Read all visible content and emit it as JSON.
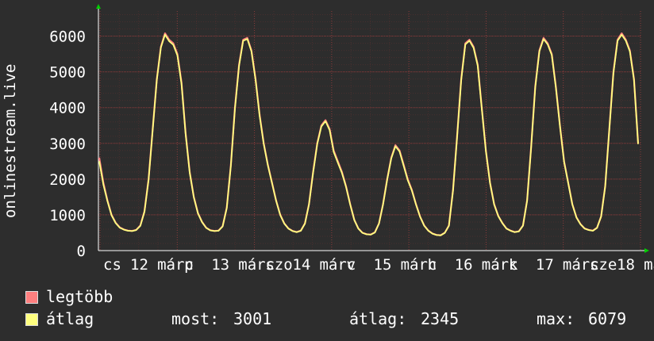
{
  "chart_data": {
    "type": "line",
    "ylabel": "onlinestream.live",
    "ylim": [
      0,
      6700
    ],
    "yticks": [
      0,
      1000,
      2000,
      3000,
      4000,
      5000,
      6000
    ],
    "x_tick_labels": [
      "cs",
      "12",
      "márc",
      "p",
      "13",
      "márc",
      "szo",
      "14",
      "márc",
      "v",
      "15",
      "márc",
      "h",
      "16",
      "márc",
      "k",
      "17",
      "márc",
      "sze",
      "18",
      "márc"
    ],
    "grid": true,
    "colors": {
      "background": "#2d2d2d",
      "plot_background": "#2d2d2d",
      "grid": "#5a3030",
      "axis": "#ffffff",
      "max_series": "#ff7f7f",
      "avg_series": "#ffff7f",
      "arrow": "#00cc00"
    },
    "series": [
      {
        "name": "legtöbb",
        "color": "#ff7f7f",
        "values": [
          2600,
          1900,
          1400,
          1000,
          780,
          650,
          590,
          560,
          550,
          580,
          700,
          1100,
          2000,
          3400,
          4800,
          5700,
          6079,
          5900,
          5800,
          5500,
          4700,
          3300,
          2200,
          1500,
          1050,
          800,
          640,
          570,
          550,
          560,
          680,
          1200,
          2400,
          4000,
          5200,
          5900,
          5950,
          5600,
          4800,
          3800,
          3000,
          2400,
          1900,
          1400,
          1000,
          760,
          620,
          550,
          520,
          560,
          760,
          1300,
          2200,
          3000,
          3500,
          3650,
          3400,
          2800,
          2500,
          2200,
          1800,
          1300,
          860,
          620,
          500,
          460,
          450,
          510,
          760,
          1300,
          2000,
          2600,
          2950,
          2800,
          2400,
          2000,
          1700,
          1300,
          950,
          700,
          560,
          480,
          440,
          430,
          500,
          700,
          1700,
          3200,
          4800,
          5800,
          5900,
          5700,
          5200,
          4000,
          2800,
          1900,
          1300,
          970,
          770,
          620,
          560,
          520,
          540,
          700,
          1400,
          2900,
          4600,
          5600,
          5950,
          5800,
          5500,
          4600,
          3500,
          2500,
          1900,
          1300,
          930,
          740,
          620,
          580,
          560,
          640,
          960,
          1800,
          3400,
          5000,
          5900,
          6079,
          5900,
          5600,
          4800,
          3000
        ]
      },
      {
        "name": "átlag",
        "color": "#ffff7f",
        "values": [
          2500,
          1850,
          1380,
          990,
          770,
          640,
          585,
          555,
          545,
          575,
          690,
          1080,
          1980,
          3380,
          4780,
          5680,
          6040,
          5860,
          5760,
          5460,
          4660,
          3270,
          2180,
          1490,
          1040,
          795,
          635,
          565,
          545,
          555,
          675,
          1190,
          2380,
          3970,
          5170,
          5870,
          5920,
          5570,
          4770,
          3770,
          2980,
          2380,
          1890,
          1390,
          995,
          755,
          615,
          545,
          515,
          555,
          755,
          1290,
          2180,
          2980,
          3470,
          3620,
          3370,
          2760,
          2460,
          2170,
          1780,
          1290,
          855,
          615,
          495,
          455,
          445,
          505,
          755,
          1290,
          1980,
          2580,
          2920,
          2770,
          2370,
          1970,
          1680,
          1290,
          945,
          695,
          555,
          475,
          435,
          425,
          495,
          695,
          1680,
          3170,
          4770,
          5770,
          5870,
          5670,
          5170,
          3970,
          2780,
          1890,
          1290,
          965,
          765,
          615,
          555,
          515,
          535,
          695,
          1390,
          2880,
          4570,
          5570,
          5920,
          5770,
          5470,
          4570,
          3480,
          2480,
          1890,
          1290,
          925,
          735,
          615,
          575,
          555,
          635,
          955,
          1790,
          3380,
          4970,
          5870,
          6040,
          5870,
          5570,
          4770,
          2980
        ]
      }
    ]
  },
  "legend": {
    "items": [
      {
        "label": "legtöbb",
        "color": "#ff7f7f"
      },
      {
        "label": "átlag",
        "color": "#ffff7f"
      }
    ],
    "stats": {
      "now_label": "most:",
      "now_value": "3001",
      "avg_label": "átlag:",
      "avg_value": "2345",
      "max_label": "max:",
      "max_value": "6079"
    }
  }
}
